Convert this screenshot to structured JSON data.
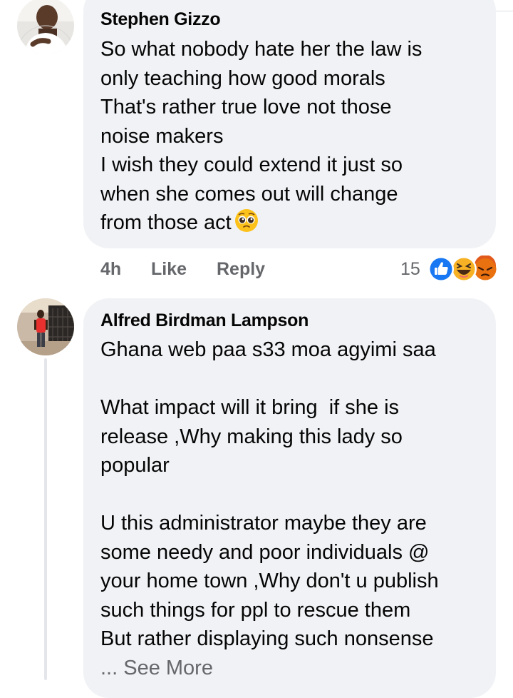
{
  "comments": [
    {
      "author": "Stephen Gizzo",
      "lines": [
        "So what nobody hate her the law is",
        "only teaching how good morals",
        "That's rather true love not those",
        "noise makers",
        "I wish they could extend it just so",
        "when she comes out will change",
        "from those act"
      ],
      "emoji": "pleading-face",
      "time": "4h",
      "like_label": "Like",
      "reply_label": "Reply",
      "reaction_count": "15",
      "reactions": [
        "like",
        "haha",
        "angry"
      ]
    },
    {
      "author": "Alfred Birdman Lampson",
      "lines": [
        "Ghana web paa s33 moa agyimi saa",
        "",
        "What impact will it bring  if she is",
        "release ,Why making this lady so",
        "popular",
        "",
        "U this administrator maybe they are",
        "some needy and poor individuals @",
        "your home town ,Why don't u publish",
        "such things for ppl to rescue them",
        "But rather displaying such nonsense"
      ],
      "see_more_prefix": "...",
      "see_more_label": "See More"
    }
  ],
  "colors": {
    "bubble": "#f0f2f5",
    "meta_text": "#65676b",
    "like_blue": "#1877f2",
    "haha_yellow": "#f7b125",
    "angry_orange": "#e9710f"
  }
}
